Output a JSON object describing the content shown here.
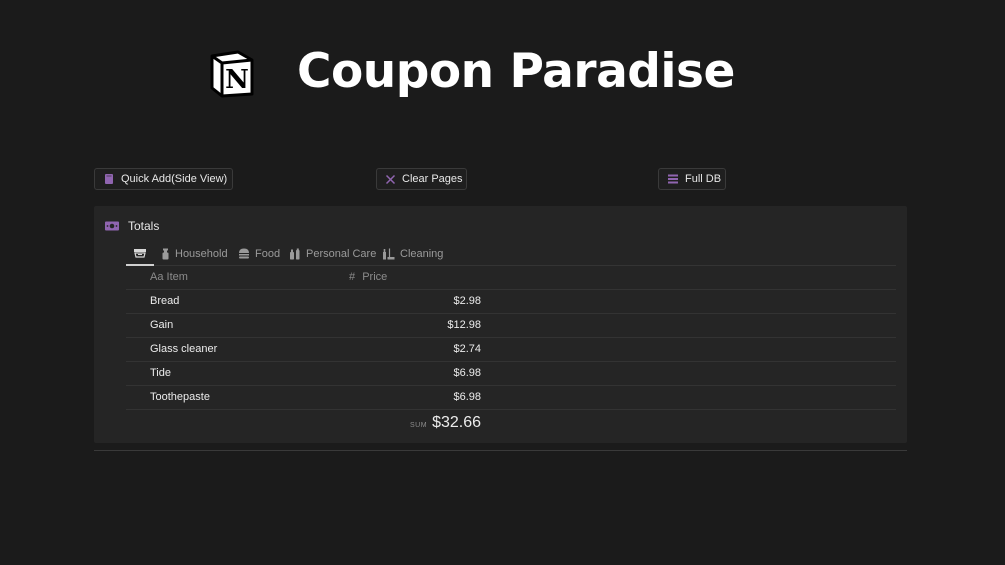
{
  "header": {
    "title": "Coupon Paradise",
    "logo_icon": "notion-logo-icon"
  },
  "buttons": {
    "quick_add": "Quick Add(Side View)",
    "clear_pages": "Clear Pages",
    "full_db": "Full DB"
  },
  "panel": {
    "title": "Totals",
    "tabs": [
      {
        "label": "",
        "icon": "cash-register-icon",
        "active": true
      },
      {
        "label": "Household",
        "icon": "spray-bottle-icon"
      },
      {
        "label": "Food",
        "icon": "burger-icon"
      },
      {
        "label": "Personal Care",
        "icon": "bottles-icon"
      },
      {
        "label": "Cleaning",
        "icon": "cleaning-supplies-icon"
      }
    ],
    "columns": {
      "item_prefix": "Aa",
      "item": "Item",
      "price_prefix": "#",
      "price": "Price"
    },
    "rows": [
      {
        "item": "Bread",
        "price": "$2.98"
      },
      {
        "item": "Gain",
        "price": "$12.98"
      },
      {
        "item": "Glass cleaner",
        "price": "$2.74"
      },
      {
        "item": "Tide",
        "price": "$6.98"
      },
      {
        "item": "Toothepaste",
        "price": "$6.98"
      }
    ],
    "sum_label": "SUM",
    "sum_value": "$32.66"
  },
  "colors": {
    "background": "#1b1b1b",
    "panel": "#252525",
    "accent": "#9065b0"
  }
}
